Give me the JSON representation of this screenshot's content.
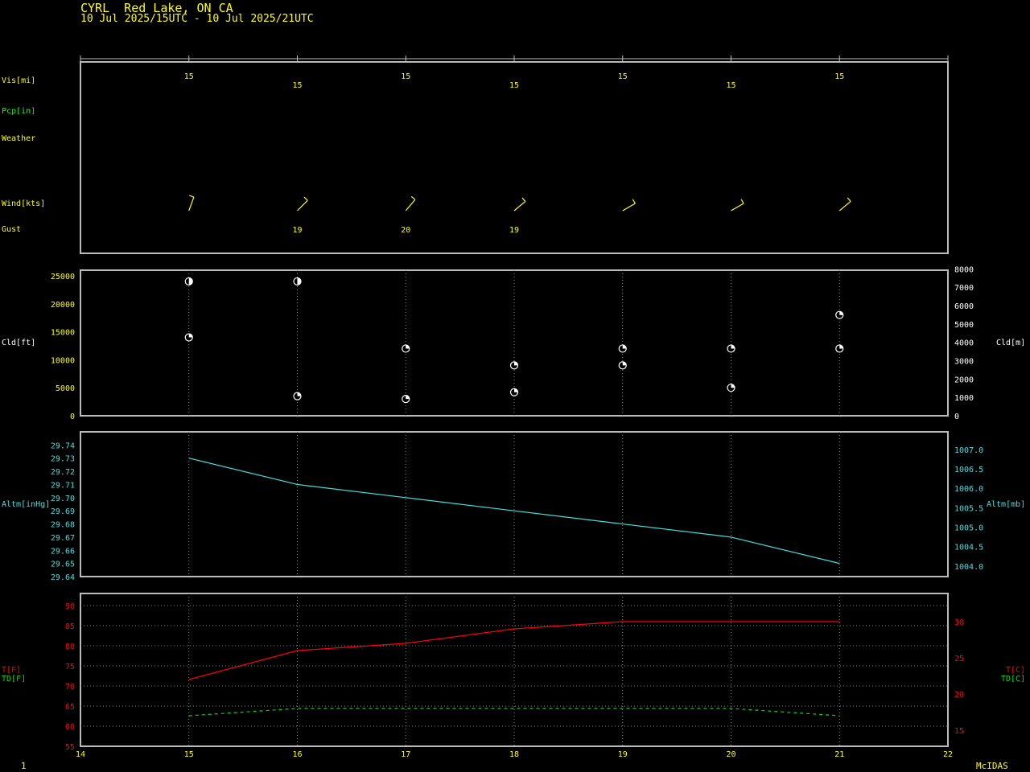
{
  "header": {
    "station": "CYRL  Red Lake, ON CA",
    "range": "10 Jul 2025/15UTC - 10 Jul 2025/21UTC",
    "footer_brand": "McIDAS",
    "page": "1"
  },
  "colors": {
    "background": "#000000",
    "frame": "#bbbbbb",
    "label_yellow": "#ffff00",
    "pcp_green": "#00ff00",
    "cloud_white": "#ffffff",
    "altimeter_cyan": "#40e0e0",
    "temp_red": "#ff0000",
    "dewpt_green": "#00dd00"
  },
  "labels": {
    "vis": "Vis[mi]",
    "pcp": "Pcp[in]",
    "weather": "Weather",
    "wind": "Wind[kts]",
    "gust": "Gust",
    "cld_ft": "Cld[ft]",
    "cld_m": "Cld[m]",
    "altm_inhg": "Altm[inHg]",
    "altm_mb": "Altm[mb]",
    "t_f": "T[F]",
    "td_f": "TD[F]",
    "t_c": "T[C]",
    "td_c": "TD[C]"
  },
  "chart_data": [
    {
      "type": "table",
      "panel": "surface-obs",
      "hours": [
        15,
        16,
        17,
        18,
        19,
        20,
        21
      ],
      "visibility_mi": [
        "15",
        "15",
        "15",
        "15",
        "15",
        "15",
        "15"
      ],
      "gust_kts": [
        {
          "hour": 16,
          "value": "19"
        },
        {
          "hour": 17,
          "value": "20"
        },
        {
          "hour": 18,
          "value": "19"
        }
      ],
      "wind_barbs": [
        {
          "hour": 15,
          "dir_deg": 200,
          "barbs": 1
        },
        {
          "hour": 16,
          "dir_deg": 225,
          "barbs": 1
        },
        {
          "hour": 17,
          "dir_deg": 220,
          "barbs": 1
        },
        {
          "hour": 18,
          "dir_deg": 230,
          "barbs": 1
        },
        {
          "hour": 19,
          "dir_deg": 240,
          "barbs": 1
        },
        {
          "hour": 20,
          "dir_deg": 240,
          "barbs": 1
        },
        {
          "hour": 21,
          "dir_deg": 230,
          "barbs": 1
        }
      ]
    },
    {
      "type": "scatter",
      "panel": "cloud",
      "ylabel": "Cld[ft]",
      "ylabel_right": "Cld[m]",
      "ylim": [
        0,
        26000
      ],
      "yticks": [
        0,
        5000,
        10000,
        15000,
        20000,
        25000
      ],
      "yticks_right": [
        0,
        1000,
        2000,
        3000,
        4000,
        5000,
        6000,
        7000,
        8000
      ],
      "points": [
        {
          "x": 15,
          "y": 24000,
          "cover": "bkn"
        },
        {
          "x": 15,
          "y": 14000,
          "cover": "sct"
        },
        {
          "x": 16,
          "y": 24000,
          "cover": "bkn"
        },
        {
          "x": 16,
          "y": 3500,
          "cover": "sct"
        },
        {
          "x": 17,
          "y": 12000,
          "cover": "sct"
        },
        {
          "x": 17,
          "y": 3000,
          "cover": "few"
        },
        {
          "x": 18,
          "y": 9000,
          "cover": "sct"
        },
        {
          "x": 18,
          "y": 4200,
          "cover": "sct"
        },
        {
          "x": 19,
          "y": 12000,
          "cover": "sct"
        },
        {
          "x": 19,
          "y": 9000,
          "cover": "sct"
        },
        {
          "x": 20,
          "y": 12000,
          "cover": "sct"
        },
        {
          "x": 20,
          "y": 5000,
          "cover": "sct"
        },
        {
          "x": 21,
          "y": 18000,
          "cover": "sct"
        },
        {
          "x": 21,
          "y": 12000,
          "cover": "sct"
        }
      ]
    },
    {
      "type": "line",
      "panel": "altimeter",
      "ylabel": "Altm[inHg]",
      "ylabel_right": "Altm[mb]",
      "ylim": [
        29.64,
        29.75
      ],
      "yticks": [
        "29.64",
        "29.65",
        "29.66",
        "29.67",
        "29.68",
        "29.69",
        "29.70",
        "29.71",
        "29.72",
        "29.73",
        "29.74"
      ],
      "yticks_right": [
        "1004.0",
        "1004.5",
        "1005.0",
        "1005.5",
        "1006.0",
        "1006.5",
        "1007.0"
      ],
      "x": [
        15,
        16,
        17,
        18,
        19,
        20,
        21
      ],
      "values": [
        29.73,
        29.71,
        29.7,
        29.69,
        29.68,
        29.67,
        29.65
      ]
    },
    {
      "type": "line",
      "panel": "temperature",
      "ylabel": "T[F]",
      "ylim": [
        55,
        93
      ],
      "yticks": [
        "55",
        "60",
        "65",
        "70",
        "75",
        "80",
        "85",
        "90"
      ],
      "yticks_right": [
        "15",
        "20",
        "25",
        "30"
      ],
      "xlim": [
        14,
        22
      ],
      "xticks": [
        "14",
        "15",
        "16",
        "17",
        "18",
        "19",
        "20",
        "21",
        "22"
      ],
      "x": [
        15,
        16,
        17,
        18,
        19,
        20,
        21
      ],
      "series": [
        {
          "name": "T[F]",
          "values": [
            71.6,
            78.8,
            80.6,
            84.2,
            86.0,
            86.0,
            86.0
          ]
        },
        {
          "name": "TD[F]",
          "values": [
            62.6,
            64.4,
            64.4,
            64.4,
            64.4,
            64.4,
            62.6
          ]
        }
      ]
    }
  ]
}
